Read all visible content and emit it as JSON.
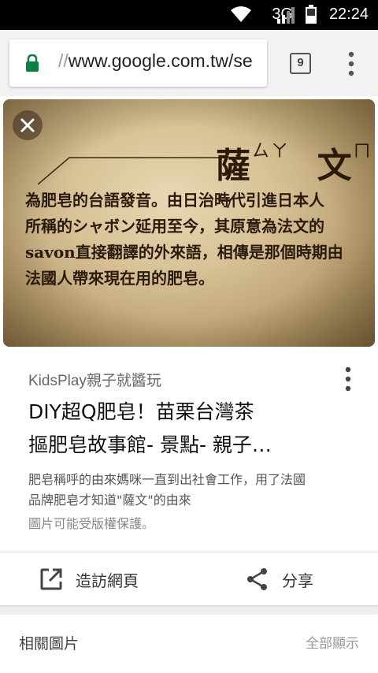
{
  "status": {
    "network": "3G",
    "time": "22:24"
  },
  "browser": {
    "url_prefix": "//",
    "url_text": "www.google.com.tw/se",
    "tab_count": "9"
  },
  "hero": {
    "heading_char1": "薩",
    "heading_kana1": "ㄙㄚ",
    "heading_char2": "文",
    "heading_kana2": "ㄇㄣ",
    "body_lines": [
      "為肥皂的台語發音。由日治時代引進日本人",
      "所稱的シャボン延用至今，其原意為法文的",
      "savon直接翻譯的外來語，相傳是那個時期由",
      "法國人帶來現在用的肥皂。"
    ]
  },
  "result": {
    "source": "KidsPlay親子就醬玩",
    "title_line1": "DIY超Q肥皂！苗栗台灣茶",
    "title_line2": "摳肥皂故事館- 景點- 親子…",
    "desc_line1": "肥皂稱呼的由來媽咪一直到出社會工作，用了法國",
    "desc_line2": "品牌肥皂才知道\"薩文\"的由來",
    "copyright_note": "圖片可能受版權保護。"
  },
  "actions": {
    "visit_label": "造訪網頁",
    "share_label": "分享"
  },
  "related": {
    "title": "相關圖片",
    "show_all": "全部顯示"
  }
}
